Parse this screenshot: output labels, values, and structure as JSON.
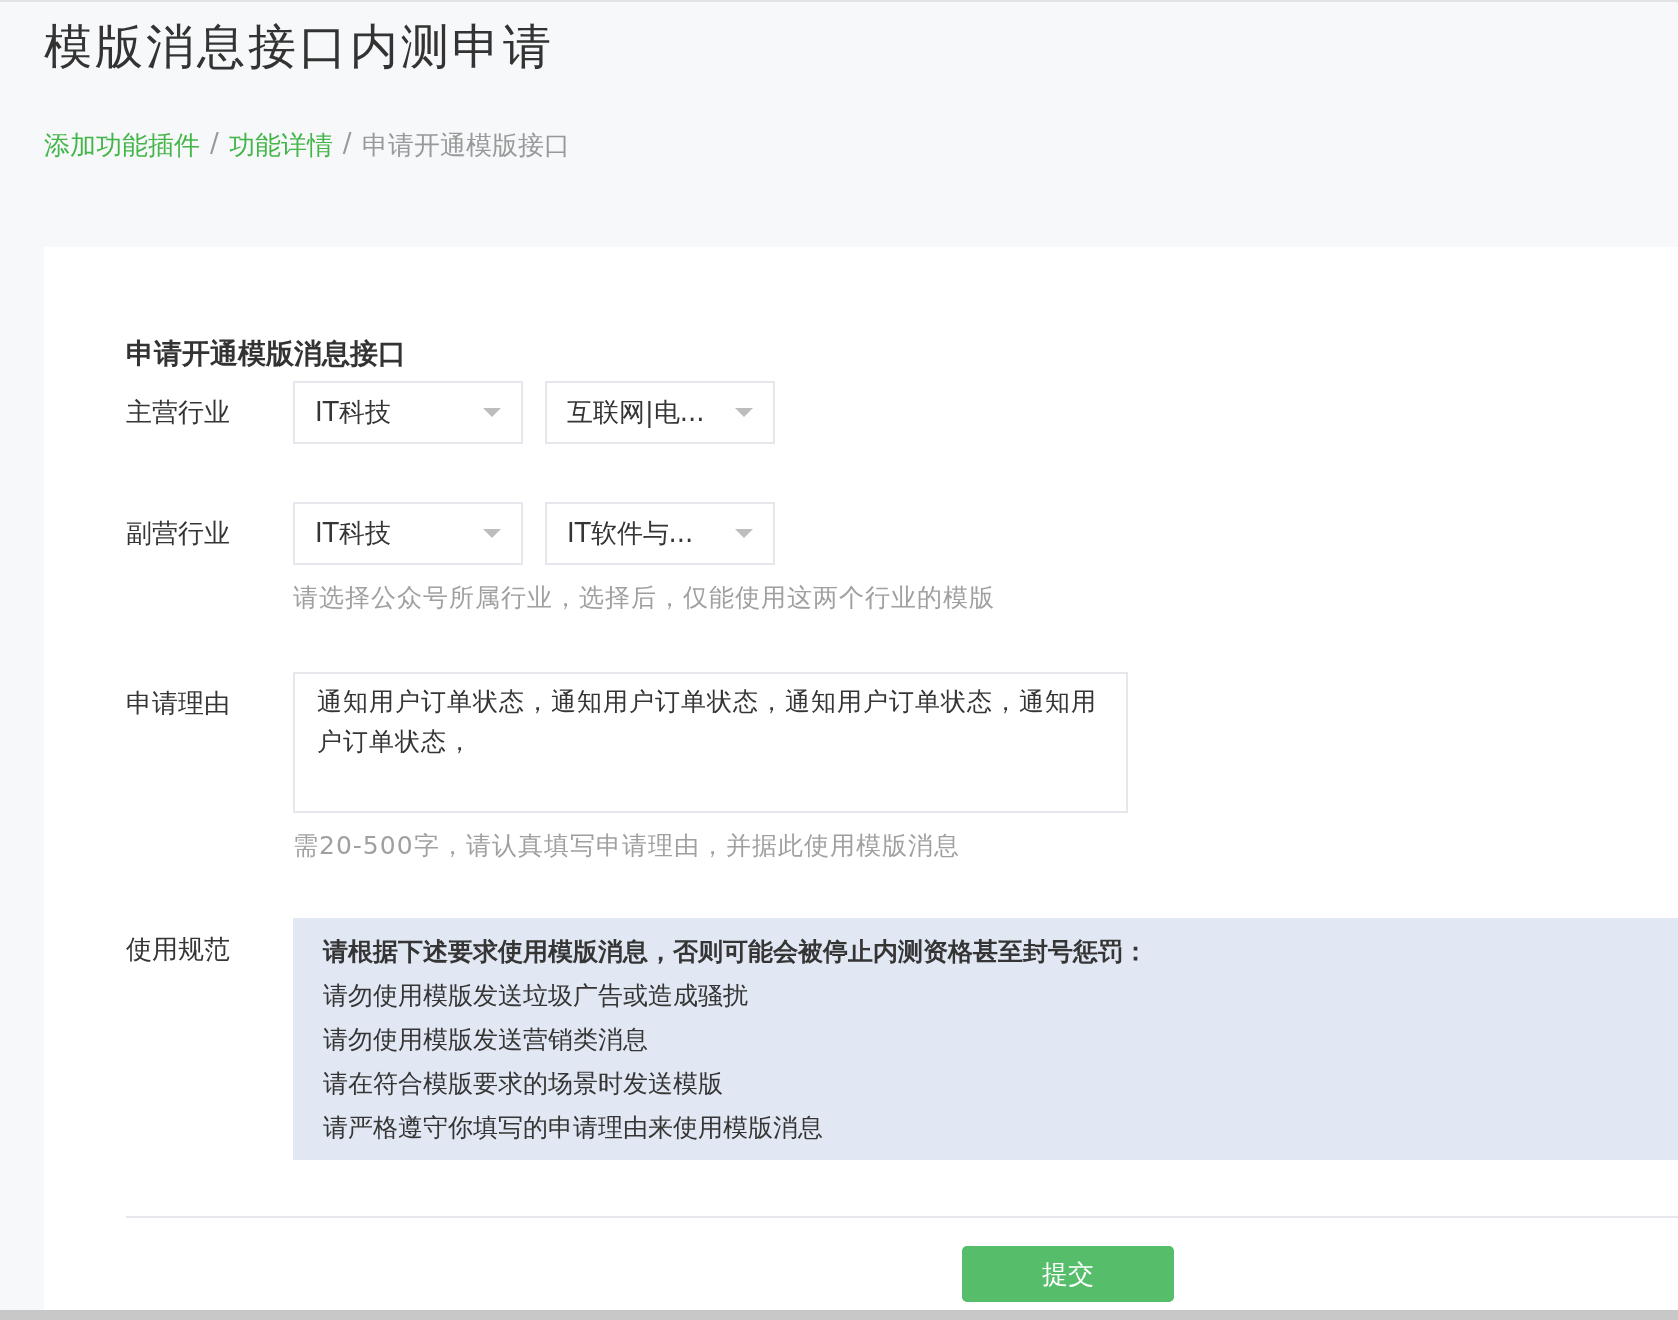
{
  "page_title": "模版消息接口内测申请",
  "breadcrumb": {
    "separator": "/",
    "items": [
      {
        "label": "添加功能插件",
        "link": true
      },
      {
        "label": "功能详情",
        "link": true
      },
      {
        "label": "申请开通模版接口",
        "link": false
      }
    ]
  },
  "form": {
    "title": "申请开通模版消息接口",
    "rows": [
      {
        "kind": "selects",
        "label": "主营行业",
        "selects": [
          "IT科技",
          "互联网|电..."
        ]
      },
      {
        "kind": "selects",
        "label": "副营行业",
        "selects": [
          "IT科技",
          "IT软件与..."
        ],
        "hint": "请选择公众号所属行业，选择后，仅能使用这两个行业的模版"
      },
      {
        "kind": "textarea",
        "label": "申请理由",
        "value": "通知用户订单状态，通知用户订单状态，通知用户订单状态，通知用户订单状态，",
        "hint": "需20-500字，请认真填写申请理由，并据此使用模版消息"
      },
      {
        "kind": "notice",
        "label": "使用规范",
        "heading": "请根据下述要求使用模版消息，否则可能会被停止内测资格甚至封号惩罚：",
        "lines": [
          "请勿使用模版发送垃圾广告或造成骚扰",
          "请勿使用模版发送营销类消息",
          "请在符合模版要求的场景时发送模版",
          "请严格遵守你填写的申请理由来使用模版消息"
        ]
      }
    ],
    "submit": "提交"
  }
}
